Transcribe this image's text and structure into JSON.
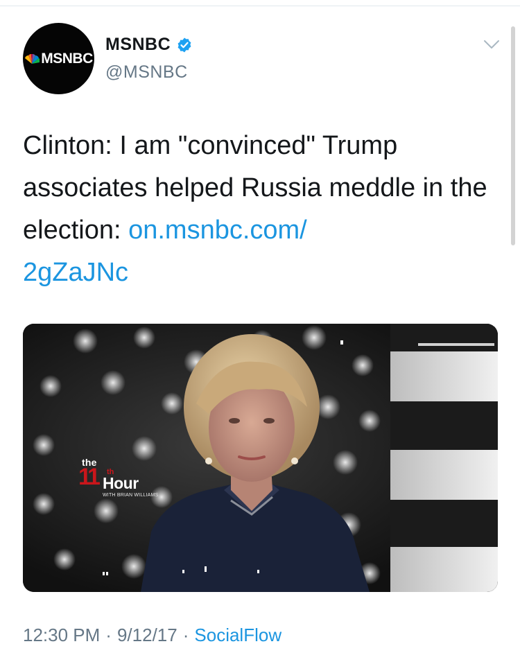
{
  "tweet": {
    "author": {
      "display_name": "MSNBC",
      "handle": "@MSNBC",
      "verified": true,
      "avatar_text": "MSNBC"
    },
    "text_plain": "Clinton: I am \"convinced\" Trump associates helped Russia meddle in the election: ",
    "link_line1": "on.msnbc.com/",
    "link_line2": "2gZaJNc",
    "media": {
      "logo_the": "the",
      "logo_number": "11",
      "logo_superscript": "th",
      "logo_word": "Hour",
      "logo_with": "WITH BRIAN WILLIAMS"
    },
    "meta": {
      "time": "12:30 PM",
      "separator": "·",
      "date": "9/12/17",
      "source": "SocialFlow"
    }
  },
  "colors": {
    "link": "#1b95e0",
    "secondary_text": "#657786",
    "verified_badge": "#1da1f2",
    "logo_red": "#c9161b"
  },
  "icons": {
    "verified": "verified-badge-icon",
    "menu": "chevron-down-icon"
  }
}
